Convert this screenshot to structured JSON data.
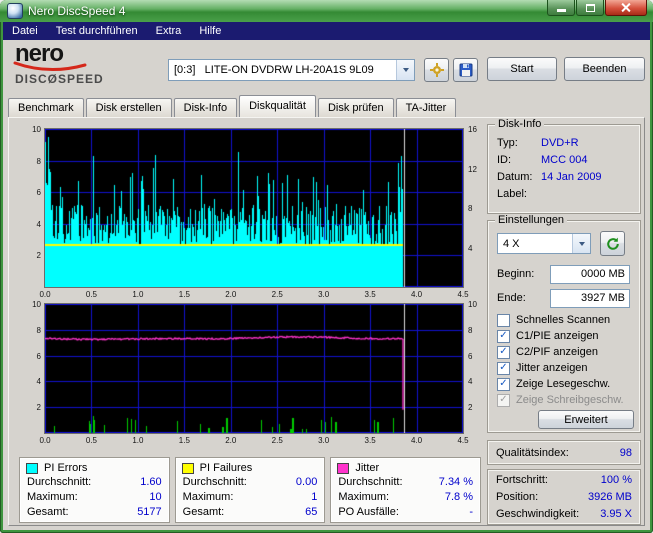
{
  "window": {
    "title": "Nero DiscSpeed 4"
  },
  "menu": [
    "Datei",
    "Test durchführen",
    "Extra",
    "Hilfe"
  ],
  "toolbar": {
    "logo": {
      "brand": "nero",
      "product_left": "DISC",
      "product_symbol": "Ø",
      "product_right": "SPEED"
    },
    "drive_select": "[0:3]   LITE-ON DVDRW LH-20A1S 9L09",
    "start_button": "Start",
    "quit_button": "Beenden"
  },
  "tabs": {
    "items": [
      "Benchmark",
      "Disk erstellen",
      "Disk-Info",
      "Diskqualität",
      "Disk prüfen",
      "TA-Jitter"
    ],
    "active_index": 3
  },
  "disk_info": {
    "title": "Disk-Info",
    "rows": [
      {
        "label": "Typ:",
        "value": "DVD+R"
      },
      {
        "label": "ID:",
        "value": "MCC 004"
      },
      {
        "label": "Datum:",
        "value": "14 Jan 2009"
      },
      {
        "label": "Label:",
        "value": ""
      }
    ]
  },
  "settings": {
    "title": "Einstellungen",
    "speed_select": "4 X",
    "begin_label": "Beginn:",
    "begin_value": "0000 MB",
    "end_label": "Ende:",
    "end_value": "3927 MB",
    "checkboxes": [
      {
        "label": "Schnelles Scannen",
        "checked": false,
        "enabled": true
      },
      {
        "label": "C1/PIE anzeigen",
        "checked": true,
        "enabled": true
      },
      {
        "label": "C2/PIF anzeigen",
        "checked": true,
        "enabled": true
      },
      {
        "label": "Jitter anzeigen",
        "checked": true,
        "enabled": true
      },
      {
        "label": "Zeige Lesegeschw.",
        "checked": true,
        "enabled": true
      },
      {
        "label": "Zeige Schreibgeschw.",
        "checked": true,
        "enabled": false
      }
    ],
    "advanced_button": "Erweitert"
  },
  "quality": {
    "label": "Qualitätsindex:",
    "value": "98"
  },
  "status": {
    "rows": [
      {
        "label": "Fortschritt:",
        "value": "100 %"
      },
      {
        "label": "Position:",
        "value": "3926 MB"
      },
      {
        "label": "Geschwindigkeit:",
        "value": "3.95 X"
      }
    ]
  },
  "stats_boxes": [
    {
      "name": "PI Errors",
      "color": "#00ffff",
      "rows": [
        {
          "label": "Durchschnitt:",
          "value": "1.60"
        },
        {
          "label": "Maximum:",
          "value": "10"
        },
        {
          "label": "Gesamt:",
          "value": "5177"
        }
      ]
    },
    {
      "name": "PI Failures",
      "color": "#ffff00",
      "rows": [
        {
          "label": "Durchschnitt:",
          "value": "0.00"
        },
        {
          "label": "Maximum:",
          "value": "1"
        },
        {
          "label": "Gesamt:",
          "value": "65"
        }
      ]
    },
    {
      "name": "Jitter",
      "color": "#ff33cc",
      "rows": [
        {
          "label": "Durchschnitt:",
          "value": "7.34 %"
        },
        {
          "label": "Maximum:",
          "value": "7.8 %"
        },
        {
          "label": "PO Ausfälle:",
          "value": "-"
        }
      ]
    }
  ],
  "chart_data": [
    {
      "type": "area",
      "title": "PI Errors / PI Failures vs. Position (GB)",
      "x_range": [
        0,
        4.5
      ],
      "x_ticks": [
        "0.0",
        "0.5",
        "1.0",
        "1.5",
        "2.0",
        "2.5",
        "3.0",
        "3.5",
        "4.0",
        "4.5"
      ],
      "data_end_x": 3.85,
      "left_ticks": [
        "10",
        "8",
        "6",
        "4",
        "2"
      ],
      "left_fracs": [
        0,
        0.2,
        0.4,
        0.6,
        0.8
      ],
      "right_ticks": [
        "16",
        "12",
        "8",
        "4"
      ],
      "right_fracs": [
        0,
        0.25,
        0.5,
        0.75
      ],
      "grid_color": "#1212d2",
      "end_marker_color": "#dcdcdc",
      "series": [
        {
          "name": "PI Errors",
          "color": "#00ffff",
          "style": "noise-columns",
          "average": 1.6,
          "maximum": 10,
          "total": 5177
        },
        {
          "name": "PI Failures",
          "color": "#ffff00",
          "style": "flat-line",
          "level_frac": 0.27,
          "average": 0.0,
          "maximum": 1,
          "total": 65
        }
      ]
    },
    {
      "type": "line",
      "title": "Jitter vs. Position (GB)",
      "x_range": [
        0,
        4.5
      ],
      "x_ticks": [
        "0.0",
        "0.5",
        "1.0",
        "1.5",
        "2.0",
        "2.5",
        "3.0",
        "3.5",
        "4.0",
        "4.5"
      ],
      "data_end_x": 3.85,
      "left_ticks": [
        "10",
        "8",
        "6",
        "4",
        "2"
      ],
      "left_fracs": [
        0,
        0.2,
        0.4,
        0.6,
        0.8
      ],
      "right_ticks": [
        "10",
        "8",
        "6",
        "4",
        "2"
      ],
      "right_fracs": [
        0,
        0.2,
        0.4,
        0.6,
        0.8
      ],
      "grid_color": "#1212d2",
      "end_marker_color": "#dcdcdc",
      "series": [
        {
          "name": "Jitter",
          "color": "#ff33cc",
          "style": "wander-line",
          "level_frac": 0.734,
          "average_percent": 7.34,
          "maximum_percent": 7.8
        },
        {
          "name": "PI Failures marks",
          "color": "#00cc00",
          "style": "bottom-spikes",
          "count": 30
        }
      ]
    }
  ]
}
